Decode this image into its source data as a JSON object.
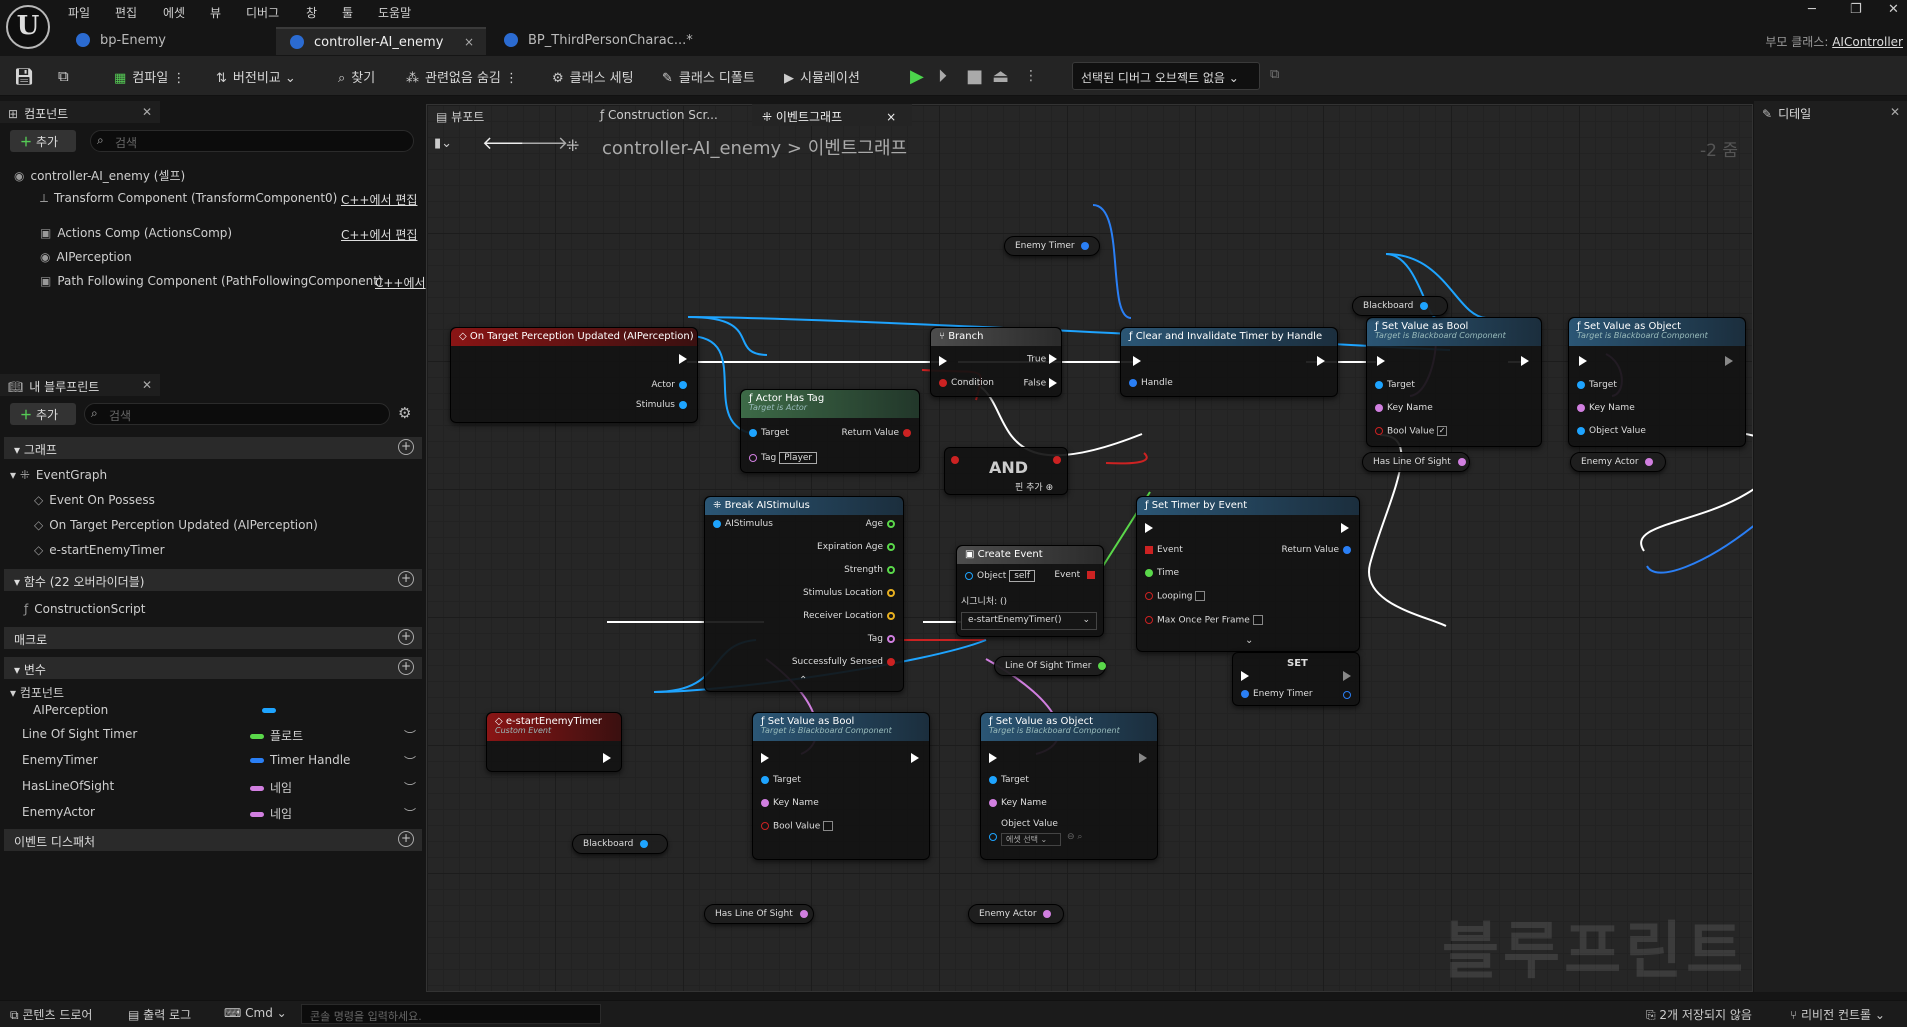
{
  "menu": [
    "파일",
    "편집",
    "에셋",
    "뷰",
    "디버그",
    "창",
    "툴",
    "도움말"
  ],
  "window_controls": {
    "min": "─",
    "restore": "❐",
    "close": "✕"
  },
  "doc_tabs": [
    {
      "label": "bp-Enemy"
    },
    {
      "label": "controller-AI_enemy",
      "close": "×"
    },
    {
      "label": "BP_ThirdPersonCharac...*"
    }
  ],
  "parent_class": {
    "label": "부모 클래스:",
    "value": "AIController"
  },
  "toolbar": {
    "compile": "컴파일",
    "diff": "버전비교",
    "find": "찾기",
    "hide_unrelated": "관련없음 숨김",
    "class_settings": "클래스 세팅",
    "class_defaults": "클래스 디폴트",
    "simulation": "시뮬레이션",
    "debug_object": "선택된 디버그 오브젝트 없음"
  },
  "components_panel": {
    "title": "컴포넌트",
    "add": "추가",
    "search_placeholder": "검색",
    "root": "controller-AI_enemy (셀프)",
    "items": [
      {
        "label": "Transform Component (TransformComponent0)",
        "action": "C++에서 편집"
      },
      {
        "label": "Actions Comp (ActionsComp)",
        "action": "C++에서 편집"
      },
      {
        "label": "AIPerception",
        "action": ""
      },
      {
        "label": "Path Following Component (PathFollowingComponent)",
        "action": "C++에서"
      }
    ]
  },
  "my_blueprint": {
    "title": "내 블루프린트",
    "add": "추가",
    "search_placeholder": "검색",
    "graph_cat": "그래프",
    "event_graph": "EventGraph",
    "events": [
      "Event On Possess",
      "On Target Perception Updated (AIPerception)",
      "e-startEnemyTimer"
    ],
    "functions_cat": "함수 (22 오버라이더블)",
    "construction": "ConstructionScript",
    "macros_cat": "매크로",
    "variables_cat": "변수",
    "components_sub": "컴포넌트",
    "variables": [
      {
        "name": "AIPerception",
        "type": "",
        "color": "#1ea4ff"
      },
      {
        "name": "Line Of Sight Timer",
        "type": "플로트",
        "color": "#5ad84a"
      },
      {
        "name": "EnemyTimer",
        "type": "Timer Handle",
        "color": "#2a7ff5"
      },
      {
        "name": "HasLineOfSight",
        "type": "네임",
        "color": "#d17fe0"
      },
      {
        "name": "EnemyActor",
        "type": "네임",
        "color": "#d17fe0"
      }
    ],
    "dispatchers_cat": "이벤트 디스패처"
  },
  "graph_tabs": [
    "뷰포트",
    "Construction Scr...",
    "이벤트그래프"
  ],
  "graph_tab_close": "×",
  "breadcrumb": {
    "root": "controller-AI_enemy",
    "sep": ">",
    "current": "이벤트그래프",
    "zoom": "-2 줌"
  },
  "nodes": {
    "on_target": {
      "title": "On Target Perception Updated (AIPerception)",
      "pins": [
        "Actor",
        "Stimulus"
      ]
    },
    "actor_has_tag": {
      "title": "Actor Has Tag",
      "sub": "Target is Actor",
      "pins": [
        "Target",
        "Tag",
        "Return Value"
      ],
      "tag_value": "Player"
    },
    "branch": {
      "title": "Branch",
      "pins": [
        "Condition",
        "True",
        "False"
      ]
    },
    "clear_timer": {
      "title": "Clear and Invalidate Timer by Handle",
      "pins": [
        "Handle"
      ]
    },
    "set_bool_1": {
      "title": "Set Value as Bool",
      "sub": "Target is Blackboard Component",
      "pins": [
        "Target",
        "Key Name",
        "Bool Value"
      ]
    },
    "set_obj_1": {
      "title": "Set Value as Object",
      "sub": "Target is Blackboard Component",
      "pins": [
        "Target",
        "Key Name",
        "Object Value"
      ]
    },
    "and": {
      "title": "AND",
      "add_pin": "핀 추가"
    },
    "break_stimulus": {
      "title": "Break AIStimulus",
      "pins": [
        "AIStimulus",
        "Age",
        "Expiration Age",
        "Strength",
        "Stimulus Location",
        "Receiver Location",
        "Tag",
        "Successfully Sensed"
      ]
    },
    "create_event": {
      "title": "Create Event",
      "pins": [
        "Object",
        "Event"
      ],
      "object_value": "self",
      "signature": "시그니처: ()",
      "selected": "e-startEnemyTimer()"
    },
    "set_timer": {
      "title": "Set Timer by Event",
      "pins": [
        "Event",
        "Time",
        "Looping",
        "Max Once Per Frame",
        "Return Value"
      ]
    },
    "set_var": {
      "title": "SET",
      "pins": [
        "Enemy Timer"
      ]
    },
    "custom_event": {
      "title": "e-startEnemyTimer",
      "sub": "Custom Event"
    },
    "set_bool_2": {
      "title": "Set Value as Bool",
      "sub": "Target is Blackboard Component",
      "pins": [
        "Target",
        "Key Name",
        "Bool Value"
      ]
    },
    "set_obj_2": {
      "title": "Set Value as Object",
      "sub": "Target is Blackboard Component",
      "pins": [
        "Target",
        "Key Name",
        "Object Value"
      ],
      "asset_select": "에셋 선택"
    }
  },
  "var_nodes": {
    "enemy_timer": "Enemy Timer",
    "blackboard_1": "Blackboard",
    "has_los_1": "Has Line Of Sight",
    "enemy_actor_1": "Enemy Actor",
    "los_timer": "Line Of Sight Timer",
    "blackboard_2": "Blackboard",
    "has_los_2": "Has Line Of Sight",
    "enemy_actor_2": "Enemy Actor"
  },
  "watermark": "블루프린트",
  "detail_panel": {
    "title": "디테일"
  },
  "statusbar": {
    "content_drawer": "콘텐츠 드로어",
    "output_log": "출력 로그",
    "cmd": "Cmd",
    "cmd_placeholder": "콘솔 명령을 입력하세요.",
    "unsaved": "2개 저장되지 않음",
    "revision": "리비전 컨트롤"
  }
}
